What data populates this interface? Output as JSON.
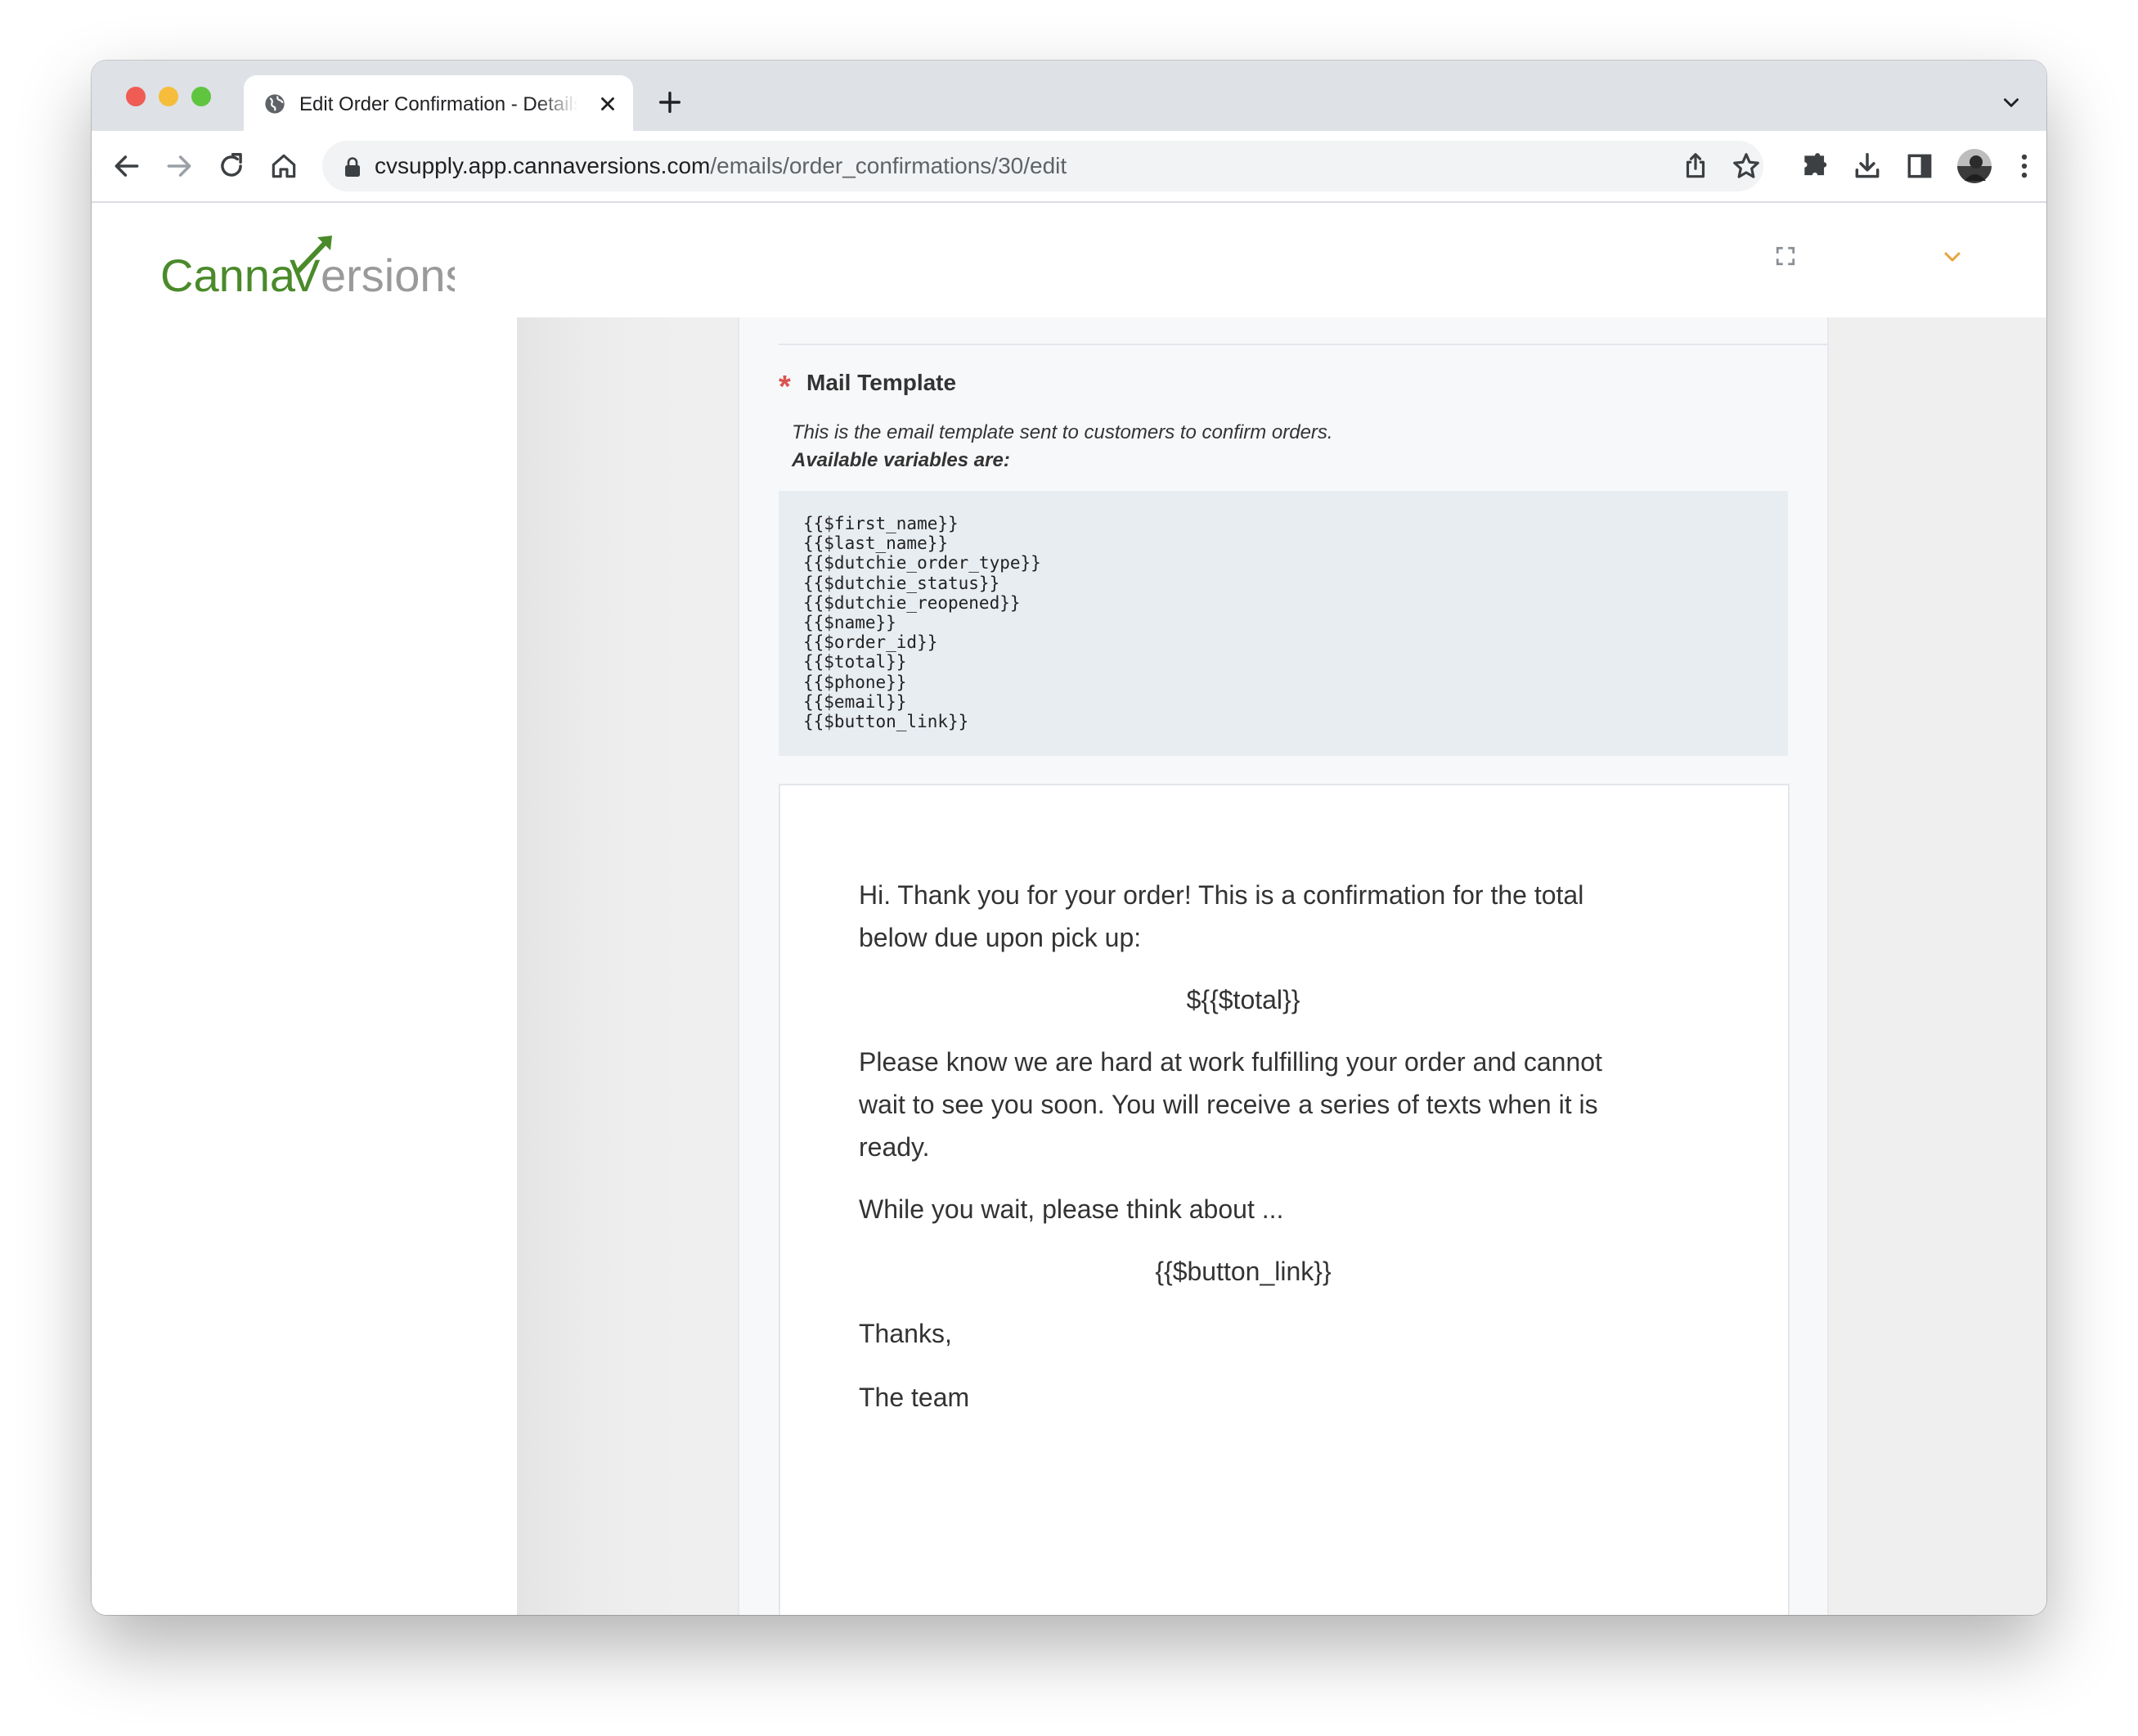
{
  "browser": {
    "tab": {
      "title": "Edit Order Confirmation - Details"
    },
    "url": {
      "host": "cvsupply.app.cannaversions.com",
      "path": "/emails/order_confirmations/30/edit"
    },
    "toolbar_icons": [
      "back-icon",
      "forward-icon",
      "reload-icon",
      "home-icon",
      "share-icon",
      "bookmark-star-icon",
      "extensions-icon",
      "download-icon",
      "side-panel-icon",
      "profile-avatar",
      "menu-kebab-icon"
    ]
  },
  "header": {
    "logo": {
      "part1": "Canna",
      "part2": "V",
      "part3": "ersions",
      "green": "#4a8a2a",
      "gray": "#9a9a9a"
    },
    "accent": "#e8a33b"
  },
  "form": {
    "field_label": "Mail Template",
    "required_marker": "*",
    "help_text": "This is the email template sent to customers to confirm orders.",
    "variables_heading": "Available variables are:",
    "variables": [
      "{{$first_name}}",
      "{{$last_name}}",
      "{{$dutchie_order_type}}",
      "{{$dutchie_status}}",
      "{{$dutchie_reopened}}",
      "{{$name}}",
      "{{$order_id}}",
      "{{$total}}",
      "{{$phone}}",
      "{{$email}}",
      "{{$button_link}}"
    ]
  },
  "editor": {
    "p1": "Hi. Thank you for your order! This is a confirmation for the total below due upon pick up:",
    "total": "${{$total}}",
    "p2": "Please know we are hard at work fulfilling your order and cannot wait to see you soon. You will receive a series of texts when it is ready.",
    "p3": "While you wait, please think about ...",
    "button_link": "{{$button_link}}",
    "p4": "Thanks,",
    "p5": "The team"
  }
}
